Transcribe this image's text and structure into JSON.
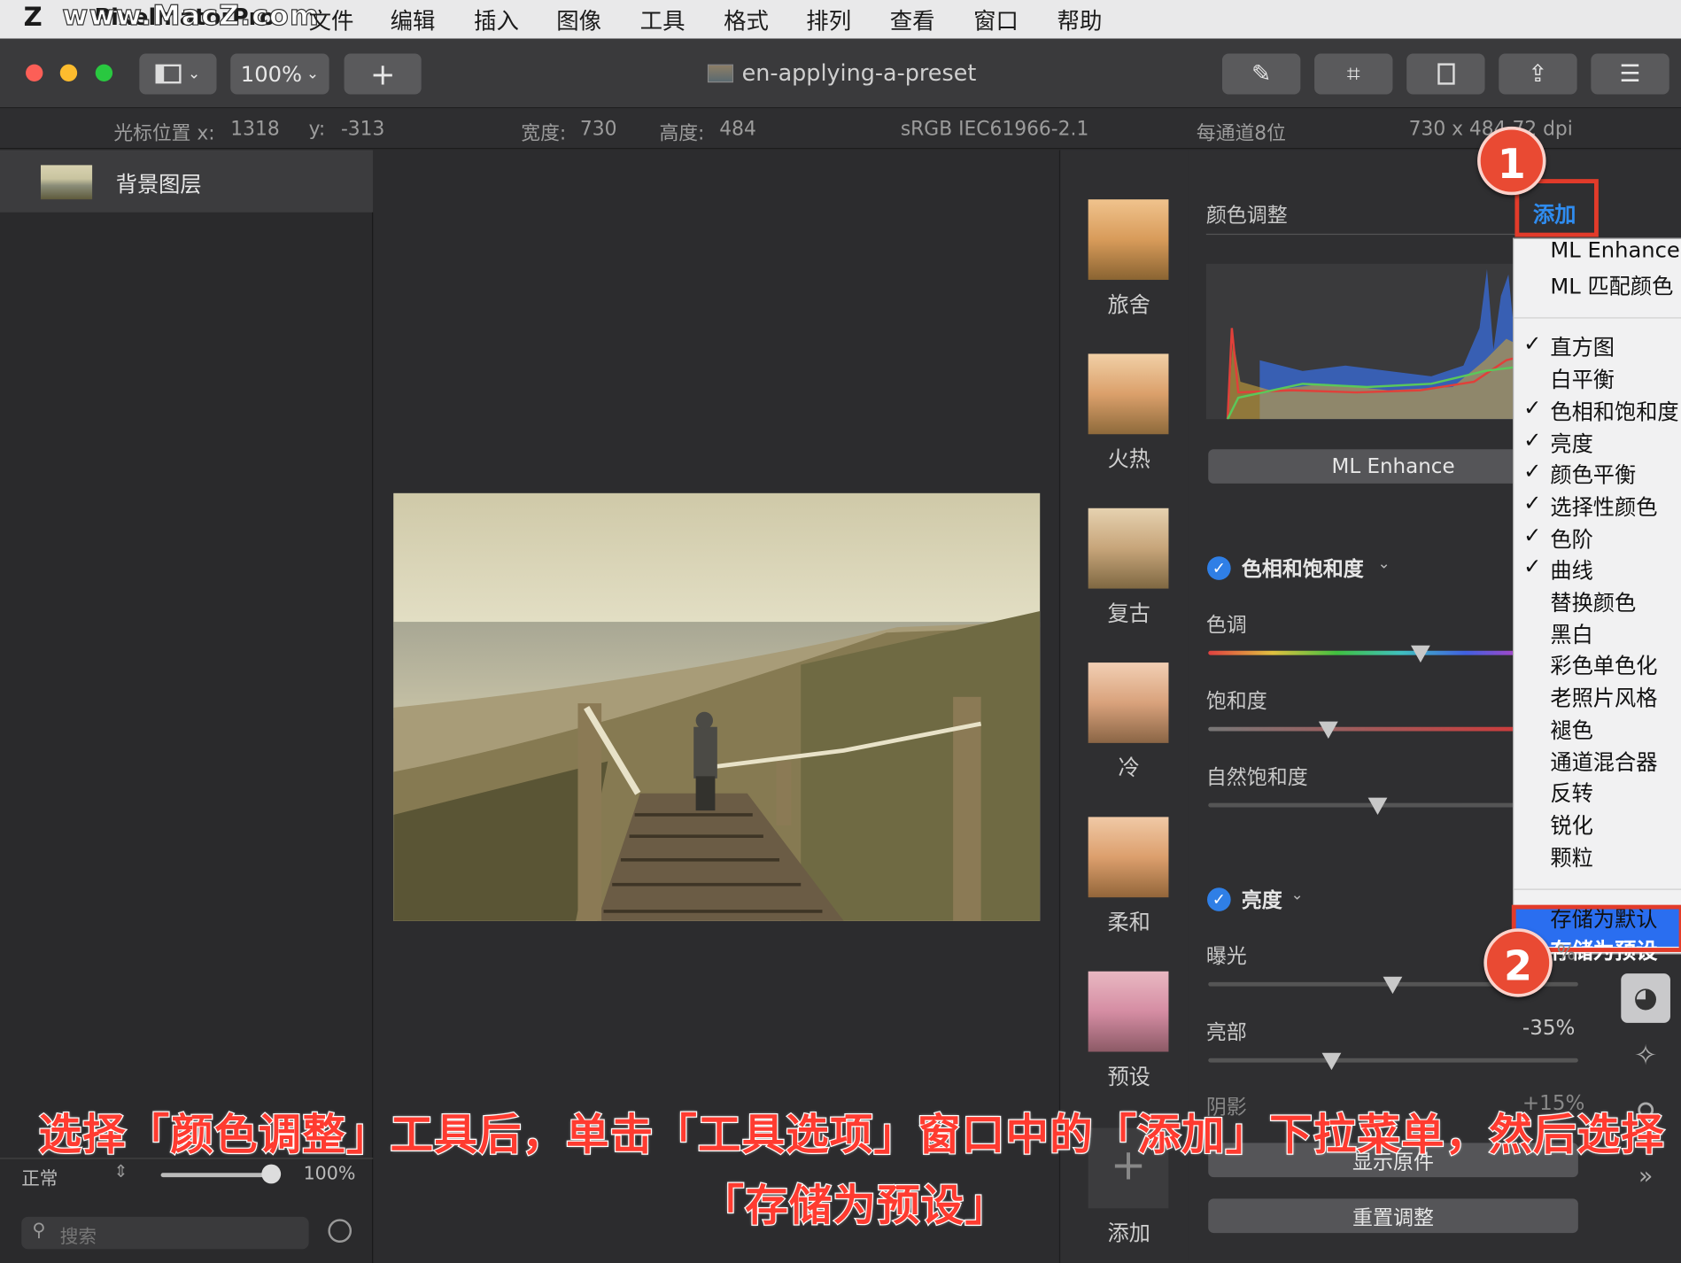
{
  "menubar": {
    "app": "PixelmatorPro",
    "watermark": "www.MacZ.com",
    "items": [
      "文件",
      "编辑",
      "插入",
      "图像",
      "工具",
      "格式",
      "排列",
      "查看",
      "窗口",
      "帮助"
    ]
  },
  "toolbar": {
    "zoom": "100%",
    "add": "+",
    "doc_title": "en-applying-a-preset"
  },
  "infobar": {
    "cursor_x_label": "光标位置 x:",
    "cursor_x": "1318",
    "cursor_y_label": "y:",
    "cursor_y": "-313",
    "width_label": "宽度:",
    "width": "730",
    "height_label": "高度:",
    "height": "484",
    "profile": "sRGB IEC61966-2.1",
    "depth": "每通道8位",
    "resolution": "730 x 484 72 dpi"
  },
  "layers": {
    "items": [
      {
        "name": "背景图层"
      }
    ],
    "blend": "正常",
    "opacity": "100%",
    "search_placeholder": "搜索"
  },
  "presets": {
    "items": [
      {
        "name": "旅舍"
      },
      {
        "name": "火热"
      },
      {
        "name": "复古"
      },
      {
        "name": "冷"
      },
      {
        "name": "柔和"
      },
      {
        "name": "预设"
      }
    ],
    "add_label": "添加"
  },
  "adjust": {
    "title": "颜色调整",
    "add_button": "添加",
    "ml_enhance": "ML Enhance",
    "hue_section": {
      "title": "色相和饱和度",
      "sliders": [
        {
          "label": "色调",
          "value": 0.7
        },
        {
          "label": "饱和度",
          "value": 0.4
        },
        {
          "label": "自然饱和度",
          "value": 0.56
        }
      ]
    },
    "light_section": {
      "title": "亮度",
      "sliders": [
        {
          "label": "曝光",
          "value": 0.5,
          "text": ""
        },
        {
          "label": "亮部",
          "value": 0.33,
          "text": "-35%"
        },
        {
          "label": "阴影",
          "value": 0.5,
          "text": "+15%"
        }
      ]
    },
    "show_original": "显示原件",
    "reset": "重置调整"
  },
  "menu": {
    "items": [
      {
        "label": "ML Enhance",
        "checked": false
      },
      {
        "label": "ML 匹配颜色",
        "checked": false
      },
      {
        "sep": true
      },
      {
        "label": "直方图",
        "checked": true
      },
      {
        "label": "白平衡",
        "checked": false
      },
      {
        "label": "色相和饱和度",
        "checked": true
      },
      {
        "label": "亮度",
        "checked": true
      },
      {
        "label": "颜色平衡",
        "checked": true
      },
      {
        "label": "选择性颜色",
        "checked": true
      },
      {
        "label": "色阶",
        "checked": true
      },
      {
        "label": "曲线",
        "checked": true
      },
      {
        "label": "替换颜色",
        "checked": false
      },
      {
        "label": "黑白",
        "checked": false
      },
      {
        "label": "彩色单色化",
        "checked": false
      },
      {
        "label": "老照片风格",
        "checked": false
      },
      {
        "label": "褪色",
        "checked": false
      },
      {
        "label": "通道混合器",
        "checked": false
      },
      {
        "label": "反转",
        "checked": false
      },
      {
        "label": "锐化",
        "checked": false
      },
      {
        "label": "颗粒",
        "checked": false
      },
      {
        "sep": true
      },
      {
        "label": "存储为默认",
        "checked": false
      },
      {
        "label": "存储为预设",
        "checked": false,
        "selected": true
      }
    ]
  },
  "annotation": {
    "badge1": "1",
    "badge2": "2",
    "caption_line1": "选择「颜色调整」工具后，单击「工具选项」窗口中的「添加」下拉菜单，然后选择",
    "caption_line2": "「存储为预设」",
    "partial_value": "%"
  },
  "colors": {
    "accent": "#2a6ef0",
    "annotation_red": "#e23b2a",
    "window_bg": "#2c2c2e"
  }
}
